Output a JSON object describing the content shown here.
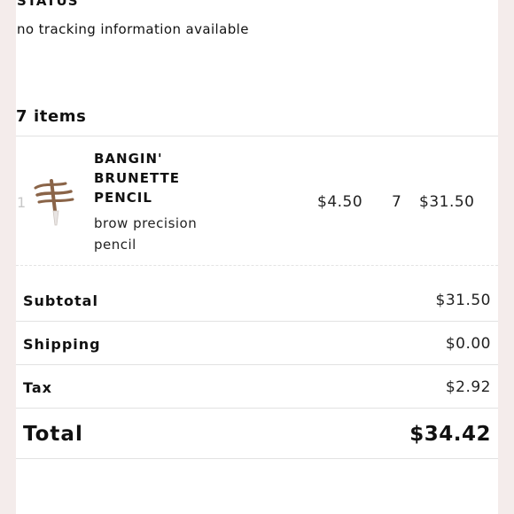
{
  "status": {
    "heading": "STATUS",
    "text": "no tracking information available"
  },
  "items_header": "7 items",
  "line_item": {
    "index": "1",
    "name": "BANGIN' BRUNETTE PENCIL",
    "description": "brow precision pencil",
    "unit_price": "$4.50",
    "quantity": "7",
    "line_total": "$31.50",
    "image_icon": "brow-pencil-swatch"
  },
  "summary": {
    "subtotal_label": "Subtotal",
    "subtotal_value": "$31.50",
    "shipping_label": "Shipping",
    "shipping_value": "$0.00",
    "tax_label": "Tax",
    "tax_value": "$2.92",
    "total_label": "Total",
    "total_value": "$34.42"
  },
  "colors": {
    "background": "#f4eceb",
    "panel": "#ffffff",
    "text": "#111111",
    "divider": "#e2e2e2",
    "pencil_brown": "#8a6448"
  }
}
